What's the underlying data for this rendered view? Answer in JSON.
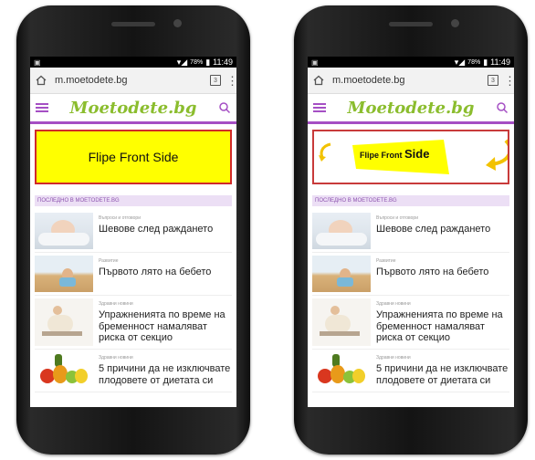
{
  "status": {
    "signal": "ᯤ",
    "battery": "78%",
    "time": "11:49"
  },
  "browser": {
    "url": "m.moetodete.bg",
    "tab_count": "3"
  },
  "site": {
    "logo": "Moetodete.bg",
    "section_title": "ПОСЛЕДНО В MOETODETE.BG"
  },
  "banners": {
    "front": "Flipe Front Side",
    "flip_small": "Flipe Front",
    "flip_big": "Side"
  },
  "articles": [
    {
      "category": "Въпроси и отговори",
      "title": "Шевове след раждането"
    },
    {
      "category": "Развитие",
      "title": "Първото лято на бебето"
    },
    {
      "category": "Здравни новини",
      "title": "Упражненията по време на бременност намаляват риска от секцио"
    },
    {
      "category": "Здравни новини",
      "title": "5 причини да не изключвате плодовете от диетата си"
    }
  ],
  "colors": {
    "accent": "#a54fc4",
    "logo": "#8bbd2e",
    "banner_bg": "#ffff00",
    "banner_border": "#d02a2a"
  }
}
